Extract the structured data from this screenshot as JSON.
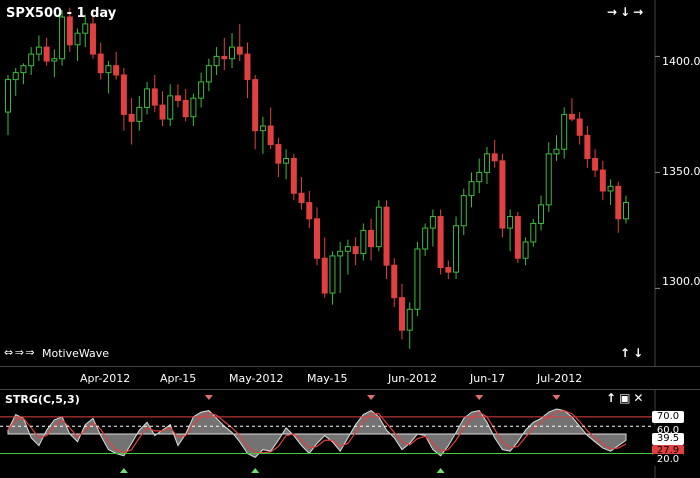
{
  "chart": {
    "title": "SPX500 - 1 day",
    "brand": "MotiveWave",
    "nav_arrows": "⇔ ⇒ ⇒",
    "price_ticks": [
      "1400.0",
      "1350.0",
      "1300.0"
    ],
    "date_ticks": [
      "Apr-2012",
      "Apr-15",
      "May-2012",
      "May-15",
      "Jun-2012",
      "Jun-17",
      "Jul-2012"
    ],
    "top_buttons": [
      "→",
      "↓",
      "→"
    ],
    "bottom_buttons": [
      "↑",
      "↓"
    ]
  },
  "indicator": {
    "title": "STRG(C,5,3)",
    "buttons": [
      "↑",
      "▣",
      "✕"
    ],
    "levels": [
      "70.0",
      "60.0",
      "39.5",
      "27.9",
      "20.0"
    ]
  },
  "colors": {
    "up": "#3dbb3d",
    "down": "#e04040",
    "ind_fill": "#9a9a9a",
    "ind_line": "#e04040",
    "upper_line": "#e04040",
    "mid_line": "#ffffff",
    "lower_line": "#40d040"
  },
  "chart_data": {
    "type": "candlestick",
    "ylim": [
      1270,
      1420
    ],
    "candles": [
      [
        1376,
        1392,
        1366,
        1390
      ],
      [
        1390,
        1395,
        1383,
        1393
      ],
      [
        1393,
        1397,
        1388,
        1396
      ],
      [
        1396,
        1404,
        1392,
        1401
      ],
      [
        1401,
        1409,
        1398,
        1404
      ],
      [
        1404,
        1408,
        1396,
        1398
      ],
      [
        1398,
        1403,
        1391,
        1399
      ],
      [
        1399,
        1420,
        1396,
        1417
      ],
      [
        1417,
        1421,
        1402,
        1405
      ],
      [
        1405,
        1412,
        1398,
        1410
      ],
      [
        1410,
        1418,
        1404,
        1414
      ],
      [
        1414,
        1419,
        1399,
        1401
      ],
      [
        1401,
        1406,
        1390,
        1393
      ],
      [
        1393,
        1398,
        1384,
        1396
      ],
      [
        1396,
        1402,
        1390,
        1392
      ],
      [
        1392,
        1395,
        1368,
        1375
      ],
      [
        1375,
        1382,
        1362,
        1372
      ],
      [
        1372,
        1383,
        1368,
        1378
      ],
      [
        1378,
        1389,
        1375,
        1386
      ],
      [
        1386,
        1392,
        1376,
        1379
      ],
      [
        1379,
        1385,
        1370,
        1373
      ],
      [
        1373,
        1388,
        1370,
        1383
      ],
      [
        1383,
        1388,
        1378,
        1381
      ],
      [
        1381,
        1386,
        1372,
        1374
      ],
      [
        1374,
        1384,
        1370,
        1382
      ],
      [
        1382,
        1393,
        1378,
        1389
      ],
      [
        1389,
        1399,
        1385,
        1396
      ],
      [
        1396,
        1404,
        1392,
        1400
      ],
      [
        1400,
        1408,
        1394,
        1399
      ],
      [
        1399,
        1410,
        1395,
        1404
      ],
      [
        1404,
        1414,
        1398,
        1401
      ],
      [
        1401,
        1406,
        1382,
        1390
      ],
      [
        1390,
        1392,
        1360,
        1368
      ],
      [
        1368,
        1374,
        1358,
        1370
      ],
      [
        1370,
        1378,
        1360,
        1362
      ],
      [
        1362,
        1365,
        1348,
        1354
      ],
      [
        1354,
        1360,
        1347,
        1356
      ],
      [
        1356,
        1358,
        1338,
        1341
      ],
      [
        1341,
        1348,
        1334,
        1337
      ],
      [
        1337,
        1342,
        1326,
        1330
      ],
      [
        1330,
        1335,
        1310,
        1313
      ],
      [
        1313,
        1322,
        1296,
        1298
      ],
      [
        1298,
        1316,
        1293,
        1314
      ],
      [
        1314,
        1320,
        1298,
        1316
      ],
      [
        1316,
        1321,
        1306,
        1318
      ],
      [
        1318,
        1322,
        1310,
        1315
      ],
      [
        1315,
        1328,
        1312,
        1325
      ],
      [
        1325,
        1330,
        1312,
        1318
      ],
      [
        1318,
        1338,
        1316,
        1335
      ],
      [
        1335,
        1338,
        1304,
        1310
      ],
      [
        1310,
        1313,
        1292,
        1296
      ],
      [
        1296,
        1302,
        1278,
        1282
      ],
      [
        1282,
        1294,
        1274,
        1291
      ],
      [
        1291,
        1320,
        1288,
        1317
      ],
      [
        1317,
        1328,
        1314,
        1326
      ],
      [
        1326,
        1334,
        1318,
        1331
      ],
      [
        1331,
        1334,
        1306,
        1309
      ],
      [
        1309,
        1312,
        1304,
        1307
      ],
      [
        1307,
        1331,
        1304,
        1327
      ],
      [
        1327,
        1343,
        1323,
        1340
      ],
      [
        1340,
        1350,
        1335,
        1346
      ],
      [
        1346,
        1356,
        1341,
        1350
      ],
      [
        1350,
        1361,
        1345,
        1358
      ],
      [
        1358,
        1364,
        1352,
        1355
      ],
      [
        1355,
        1358,
        1322,
        1326
      ],
      [
        1326,
        1334,
        1316,
        1331
      ],
      [
        1331,
        1333,
        1311,
        1313
      ],
      [
        1313,
        1322,
        1310,
        1320
      ],
      [
        1320,
        1330,
        1318,
        1328
      ],
      [
        1328,
        1340,
        1325,
        1336
      ],
      [
        1336,
        1363,
        1333,
        1358
      ],
      [
        1358,
        1366,
        1355,
        1360
      ],
      [
        1360,
        1378,
        1356,
        1375
      ],
      [
        1375,
        1382,
        1372,
        1373
      ],
      [
        1373,
        1376,
        1362,
        1366
      ],
      [
        1366,
        1370,
        1352,
        1356
      ],
      [
        1356,
        1360,
        1348,
        1351
      ],
      [
        1351,
        1355,
        1338,
        1342
      ],
      [
        1342,
        1347,
        1336,
        1344
      ],
      [
        1344,
        1346,
        1324,
        1330
      ],
      [
        1330,
        1340,
        1328,
        1337
      ]
    ],
    "oscillator": {
      "values": [
        55,
        75,
        70,
        45,
        35,
        55,
        68,
        72,
        50,
        40,
        62,
        70,
        48,
        30,
        25,
        22,
        38,
        55,
        65,
        48,
        55,
        62,
        35,
        50,
        72,
        78,
        80,
        70,
        60,
        52,
        40,
        25,
        20,
        30,
        28,
        42,
        58,
        48,
        35,
        25,
        38,
        48,
        40,
        28,
        45,
        62,
        75,
        80,
        72,
        55,
        45,
        30,
        38,
        50,
        48,
        30,
        22,
        35,
        52,
        70,
        78,
        80,
        65,
        45,
        30,
        28,
        40,
        55,
        65,
        70,
        78,
        82,
        80,
        72,
        60,
        48,
        40,
        32,
        28,
        35,
        42
      ],
      "signal": [
        55,
        68,
        70,
        58,
        45,
        48,
        60,
        68,
        58,
        46,
        55,
        64,
        56,
        40,
        30,
        26,
        30,
        45,
        58,
        54,
        54,
        58,
        46,
        48,
        62,
        72,
        77,
        74,
        66,
        58,
        48,
        34,
        26,
        26,
        27,
        34,
        48,
        50,
        42,
        32,
        34,
        42,
        42,
        34,
        38,
        52,
        66,
        76,
        76,
        64,
        52,
        40,
        36,
        44,
        47,
        38,
        28,
        30,
        42,
        58,
        70,
        78,
        72,
        56,
        40,
        32,
        34,
        46,
        57,
        65,
        72,
        78,
        80,
        76,
        66,
        54,
        45,
        37,
        31,
        32,
        37
      ]
    }
  }
}
